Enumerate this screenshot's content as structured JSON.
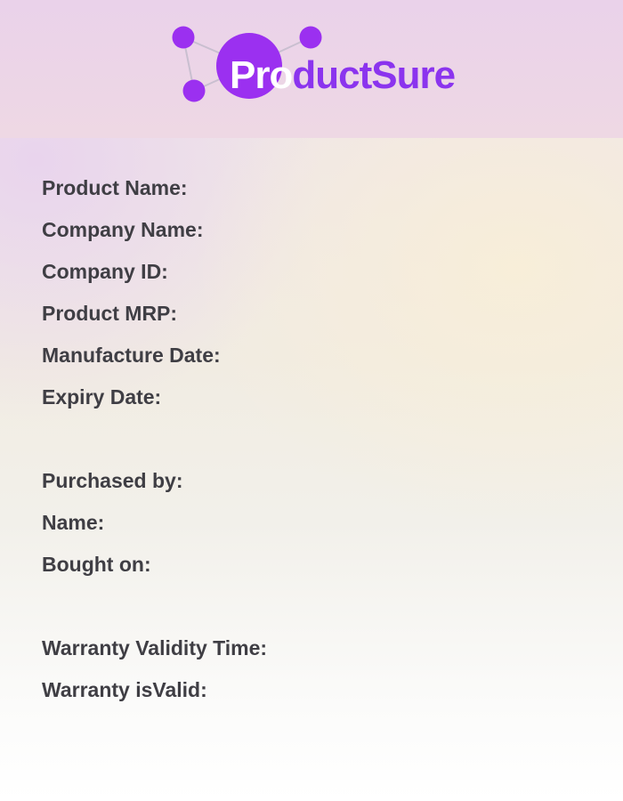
{
  "brand": {
    "name_lead": "Pro",
    "name_rest": "ductSure",
    "logo_icon": "network-nodes-icon"
  },
  "colors": {
    "brand_purple": "#8b34ee",
    "node_purple": "#9b30f0",
    "label_text": "#3f3e44"
  },
  "fields": {
    "product_name": "Product Name:",
    "company_name": "Company Name:",
    "company_id": "Company ID:",
    "product_mrp": "Product MRP:",
    "manufacture_date": "Manufacture Date:",
    "expiry_date": "Expiry Date:",
    "purchased_by": "Purchased by:",
    "name": "Name:",
    "bought_on": "Bought on:",
    "warranty_validity_time": "Warranty Validity Time:",
    "warranty_is_valid": "Warranty isValid:"
  }
}
